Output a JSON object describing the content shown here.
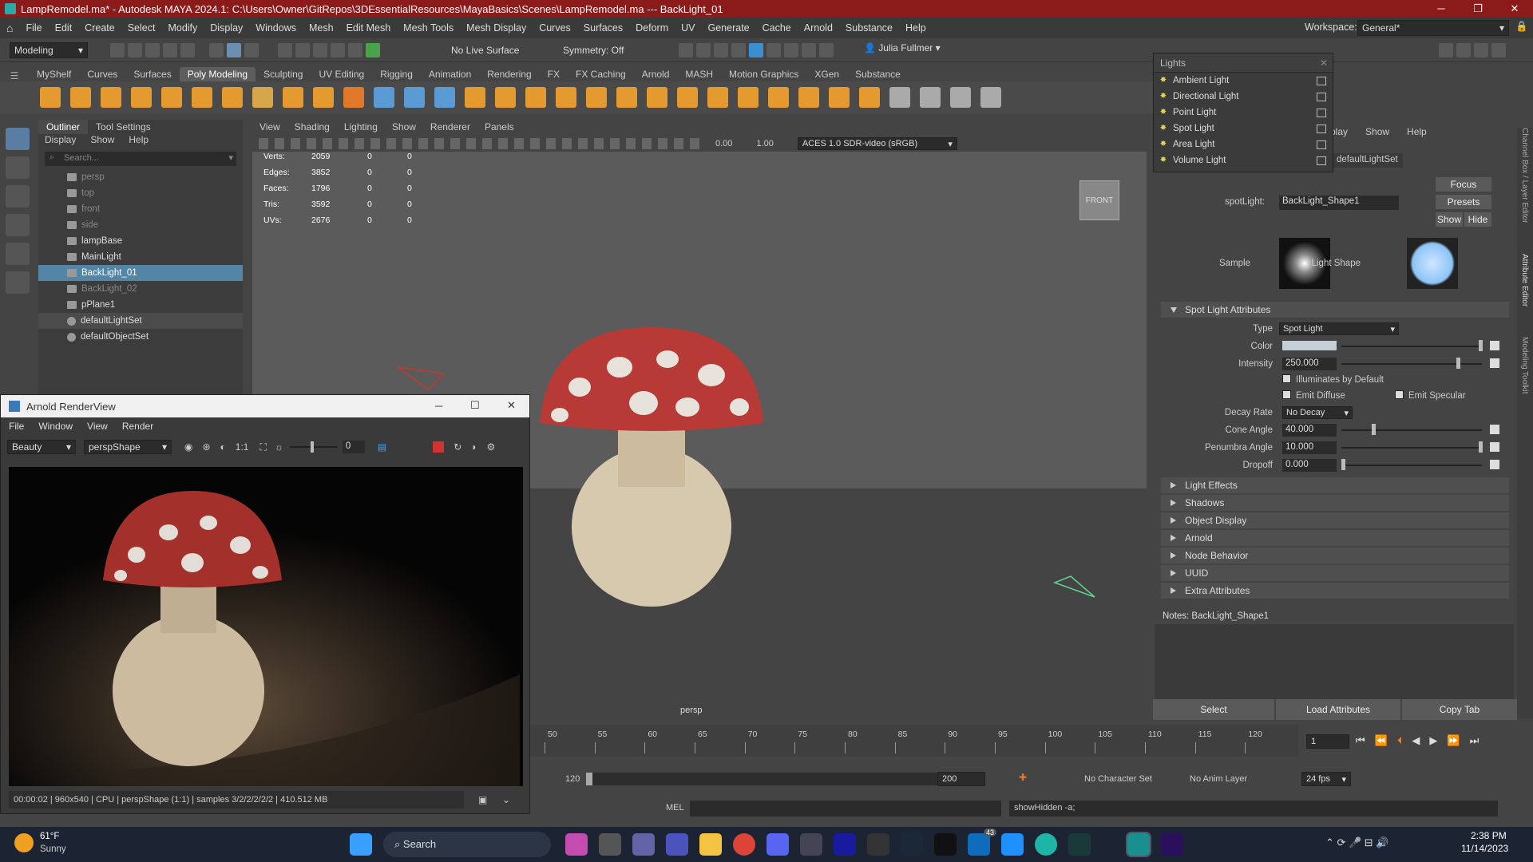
{
  "window": {
    "title": "LampRemodel.ma* - Autodesk MAYA 2024.1: C:\\Users\\Owner\\GitRepos\\3DEssentialResources\\MayaBasics\\Scenes\\LampRemodel.ma   ---   BackLight_01"
  },
  "menubar": [
    "File",
    "Edit",
    "Create",
    "Select",
    "Modify",
    "Display",
    "Windows",
    "Mesh",
    "Edit Mesh",
    "Mesh Tools",
    "Mesh Display",
    "Curves",
    "Surfaces",
    "Deform",
    "UV",
    "Generate",
    "Cache",
    "Arnold",
    "Substance",
    "Help"
  ],
  "workspace": {
    "label": "Workspace:",
    "value": "General*"
  },
  "statusline": {
    "mode": "Modeling",
    "live_surface": "No Live Surface",
    "symmetry": "Symmetry: Off",
    "user": "Julia Fullmer"
  },
  "shelf_tabs": [
    "MyShelf",
    "Curves",
    "Surfaces",
    "Poly Modeling",
    "Sculpting",
    "UV Editing",
    "Rigging",
    "Animation",
    "Rendering",
    "FX",
    "FX Caching",
    "Arnold",
    "MASH",
    "Motion Graphics",
    "XGen",
    "Substance"
  ],
  "shelf_active": "Poly Modeling",
  "outliner": {
    "tabs": [
      "Outliner",
      "Tool Settings"
    ],
    "menu": [
      "Display",
      "Show",
      "Help"
    ],
    "search_placeholder": "Search...",
    "items": [
      {
        "label": "persp",
        "state": "dim",
        "icon": "camera-icon"
      },
      {
        "label": "top",
        "state": "dim",
        "icon": "camera-icon"
      },
      {
        "label": "front",
        "state": "dim",
        "icon": "camera-icon"
      },
      {
        "label": "side",
        "state": "dim",
        "icon": "camera-icon"
      },
      {
        "label": "lampBase",
        "state": "normal",
        "icon": "mesh-icon"
      },
      {
        "label": "MainLight",
        "state": "normal",
        "icon": "light-icon"
      },
      {
        "label": "BackLight_01",
        "state": "selected",
        "icon": "light-icon"
      },
      {
        "label": "BackLight_02",
        "state": "dim",
        "icon": "light-icon"
      },
      {
        "label": "pPlane1",
        "state": "normal",
        "icon": "mesh-icon"
      },
      {
        "label": "defaultLightSet",
        "state": "set",
        "icon": "set-icon"
      },
      {
        "label": "defaultObjectSet",
        "state": "normal",
        "icon": "set-icon"
      }
    ]
  },
  "viewport": {
    "menu": [
      "View",
      "Shading",
      "Lighting",
      "Show",
      "Renderer",
      "Panels"
    ],
    "num1": "0.00",
    "num2": "1.00",
    "colorspace": "ACES 1.0 SDR-video (sRGB)",
    "hud": [
      {
        "label": "Verts:",
        "v": "2059",
        "a": "0",
        "b": "0"
      },
      {
        "label": "Edges:",
        "v": "3852",
        "a": "0",
        "b": "0"
      },
      {
        "label": "Faces:",
        "v": "1796",
        "a": "0",
        "b": "0"
      },
      {
        "label": "Tris:",
        "v": "3592",
        "a": "0",
        "b": "0"
      },
      {
        "label": "UVs:",
        "v": "2676",
        "a": "0",
        "b": "0"
      }
    ],
    "cube_label": "FRONT",
    "camera_label": "persp"
  },
  "timeslider": {
    "ticks": [
      "50",
      "55",
      "60",
      "65",
      "70",
      "75",
      "80",
      "85",
      "90",
      "95",
      "100",
      "105",
      "110",
      "115",
      "120"
    ],
    "current_frame": "1"
  },
  "range": {
    "end": "120",
    "max": "200",
    "character_set": "No Character Set",
    "anim_layer": "No Anim Layer",
    "fps": "24 fps"
  },
  "mel": {
    "label": "MEL",
    "command": "showHidden -a;"
  },
  "lights_popup": {
    "title": "Lights",
    "items": [
      "Ambient Light",
      "Directional Light",
      "Point Light",
      "Spot Light",
      "Area Light",
      "Volume Light"
    ]
  },
  "attr_editor": {
    "menu_partial": [
      "play",
      "Show",
      "Help"
    ],
    "tab_partial": "defaultLightSet",
    "node_label": "spotLight:",
    "node_value": "BackLight_Shape1",
    "buttons": [
      "Focus",
      "Presets",
      "Show",
      "Hide"
    ],
    "sample_label": "Sample",
    "shape_label": "Light Shape",
    "section_title": "Spot Light Attributes",
    "type_label": "Type",
    "type_value": "Spot Light",
    "color_label": "Color",
    "color_value": "#c5cfd8",
    "intensity_label": "Intensity",
    "intensity_value": "250.000",
    "illum_label": "Illuminates by Default",
    "diffuse_label": "Emit Diffuse",
    "specular_label": "Emit Specular",
    "decay_label": "Decay Rate",
    "decay_value": "No Decay",
    "cone_label": "Cone Angle",
    "cone_value": "40.000",
    "penumbra_label": "Penumbra Angle",
    "penumbra_value": "10.000",
    "dropoff_label": "Dropoff",
    "dropoff_value": "0.000",
    "sections": [
      "Light Effects",
      "Shadows",
      "Object Display",
      "Arnold",
      "Node Behavior",
      "UUID",
      "Extra Attributes"
    ],
    "notes": "Notes:  BackLight_Shape1",
    "bottom_buttons": [
      "Select",
      "Load Attributes",
      "Copy Tab"
    ],
    "side_tabs": [
      "Channel Box / Layer Editor",
      "Attribute Editor",
      "Modeling Toolkit"
    ]
  },
  "renderview": {
    "title": "Arnold RenderView",
    "menu": [
      "File",
      "Window",
      "View",
      "Render"
    ],
    "aov": "Beauty",
    "camera": "perspShape",
    "ratio": "1:1",
    "exposure": "0",
    "status": "00:00:02 | 960x540 | CPU | perspShape (1:1) | samples 3/2/2/2/2/2 | 410.512 MB"
  },
  "taskbar": {
    "weather_temp": "61°F",
    "weather_desc": "Sunny",
    "search": "Search",
    "time": "2:38 PM",
    "date": "11/14/2023",
    "badge": "43"
  }
}
